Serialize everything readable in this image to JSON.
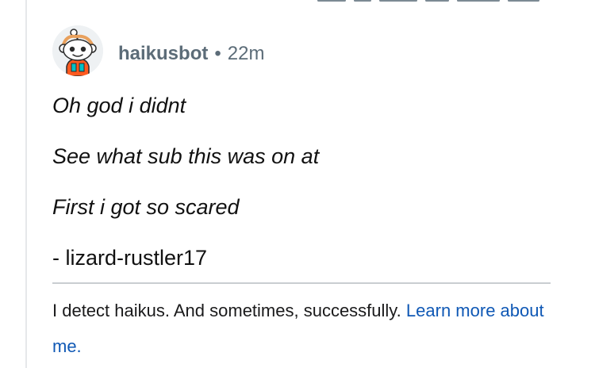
{
  "comment": {
    "author": "haikusbot",
    "separator": "•",
    "time": "22m",
    "avatar_icon": "snoo-avatar-icon",
    "body_lines": [
      "Oh god i didnt",
      "See what sub this was on at",
      "First i got so scared"
    ],
    "signature": "- lizard-rustler17",
    "footer_text": "I detect haikus. And sometimes, successfully.",
    "footer_link": "Learn more about me."
  },
  "colors": {
    "meta": "#5c6c78",
    "body": "#111111",
    "link": "#0f58b5",
    "divider": "#c9cdd1",
    "thread_line": "#e6e8ea"
  }
}
